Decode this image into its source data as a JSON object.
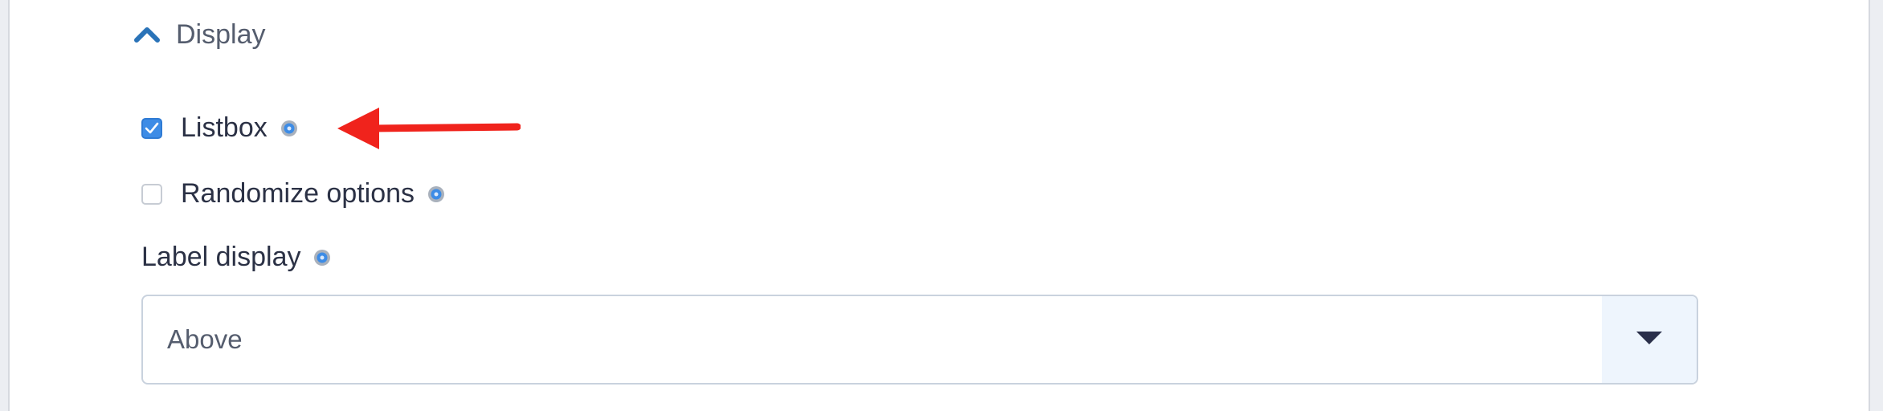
{
  "section": {
    "title": "Display",
    "expanded": true,
    "icon": "chevron-up-icon"
  },
  "options": [
    {
      "label": "Listbox",
      "checked": true,
      "help_icon": "help-icon"
    },
    {
      "label": "Randomize options",
      "checked": false,
      "help_icon": "help-icon"
    }
  ],
  "label_display": {
    "label": "Label display",
    "help_icon": "help-icon",
    "selected": "Above",
    "dropdown_icon": "caret-down-icon"
  },
  "annotation": {
    "type": "arrow",
    "color": "#f0231c",
    "points_to": "Listbox help icon"
  },
  "colors": {
    "accent": "#3d8ce6",
    "chevron": "#2a73b8",
    "text": "#2b3145",
    "muted_text": "#555d6e",
    "select_button_bg": "#eef5fd",
    "caret": "#2a2f4a"
  }
}
